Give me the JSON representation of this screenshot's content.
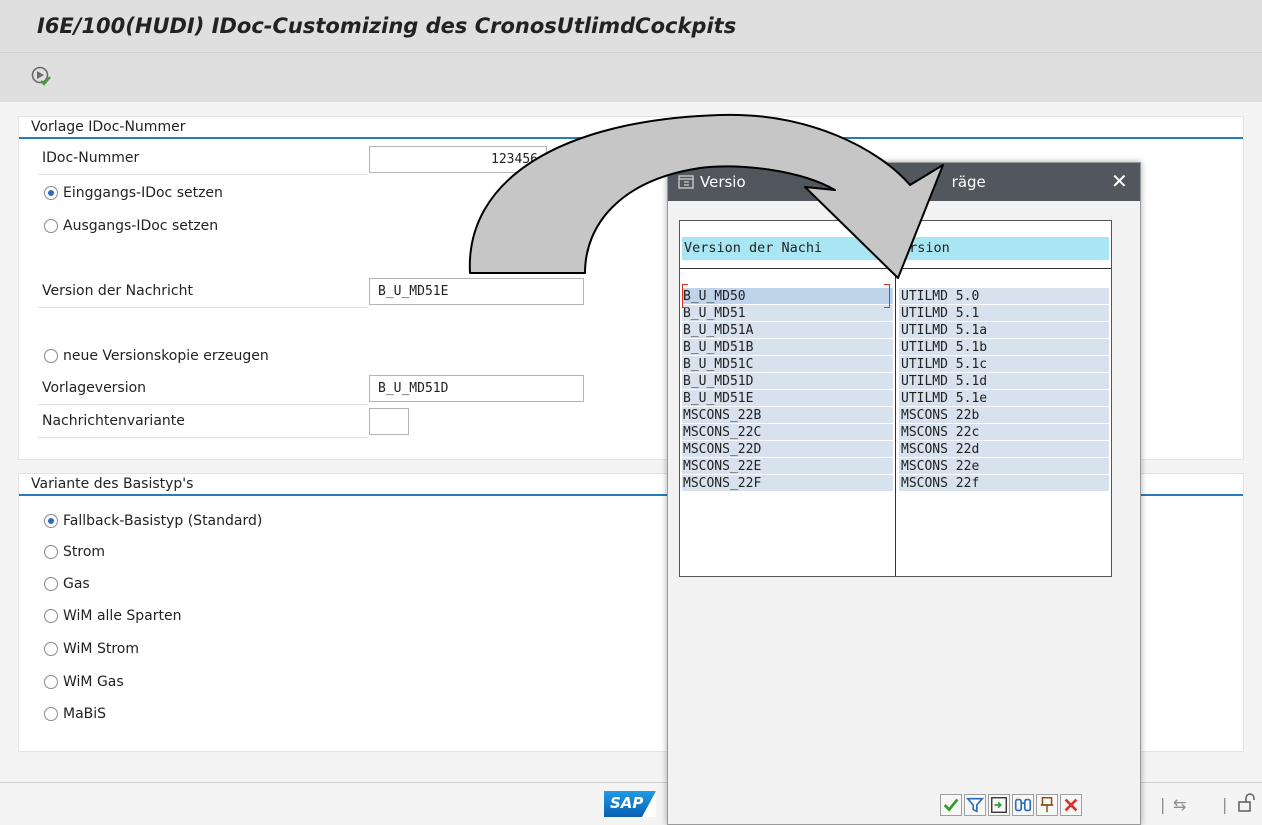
{
  "window": {
    "title": "I6E/100(HUDI) IDoc-Customizing des CronosUtlimdCockpits"
  },
  "toolbar": {
    "execute_icon": "execute-icon"
  },
  "group1": {
    "title": "Vorlage IDoc-Nummer",
    "idoc_label": "IDoc-Nummer",
    "idoc_value": "123456",
    "radio_inbound": "Einggangs-IDoc setzen",
    "radio_outbound": "Ausgangs-IDoc setzen",
    "version_label": "Version der Nachricht",
    "version_value": "B_U_MD51E",
    "radio_new_copy": "neue Versionskopie erzeugen",
    "template_label": "Vorlageversion",
    "template_value": "B_U_MD51D",
    "variant_label": "Nachrichtenvariante",
    "variant_value": ""
  },
  "group2": {
    "title": "Variante des Basistyp's",
    "options": [
      "Fallback-Basistyp (Standard)",
      "Strom",
      "Gas",
      "WiM alle Sparten",
      "WiM Strom",
      "WiM Gas",
      "MaBiS"
    ],
    "selected": "Fallback-Basistyp (Standard)"
  },
  "dialog": {
    "title_left": "Versio",
    "title_right": "räge",
    "close": "✕",
    "col1_header": "Version der Nachi",
    "col2_header": "ersion",
    "rows": [
      {
        "version": "B_U_MD50",
        "desc": "UTILMD 5.0"
      },
      {
        "version": "B_U_MD51",
        "desc": "UTILMD 5.1"
      },
      {
        "version": "B_U_MD51A",
        "desc": "UTILMD 5.1a"
      },
      {
        "version": "B_U_MD51B",
        "desc": "UTILMD 5.1b"
      },
      {
        "version": "B_U_MD51C",
        "desc": "UTILMD 5.1c"
      },
      {
        "version": "B_U_MD51D",
        "desc": "UTILMD 5.1d"
      },
      {
        "version": "B_U_MD51E",
        "desc": "UTILMD 5.1e"
      },
      {
        "version": "MSCONS_22B",
        "desc": "MSCONS 22b"
      },
      {
        "version": "MSCONS_22C",
        "desc": "MSCONS 22c"
      },
      {
        "version": "MSCONS_22D",
        "desc": "MSCONS 22d"
      },
      {
        "version": "MSCONS_22E",
        "desc": "MSCONS 22e"
      },
      {
        "version": "MSCONS_22F",
        "desc": "MSCONS 22f"
      }
    ],
    "buttons": [
      "check-icon",
      "filter-icon",
      "export-icon",
      "find-icon",
      "pin-icon",
      "cancel-icon"
    ]
  },
  "footer": {
    "logo": "SAP"
  },
  "colors": {
    "accent": "#2a7bb8",
    "dialog_header": "#51575c",
    "row_bg": "#d7e2ee",
    "header_bg": "#a7e6f2"
  }
}
